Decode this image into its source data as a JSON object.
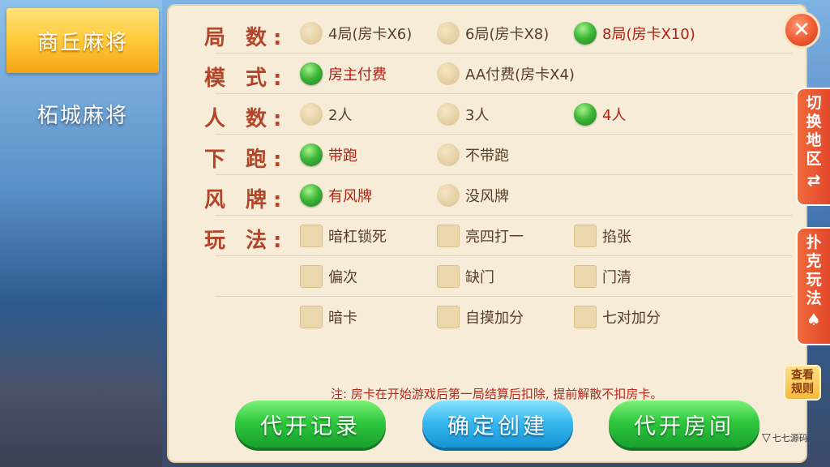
{
  "sidebar": {
    "items": [
      {
        "label": "商丘麻将",
        "active": true
      },
      {
        "label": "柘城麻将",
        "active": false
      }
    ]
  },
  "settings": {
    "rounds": {
      "label": "局 数:",
      "options": [
        "4局(房卡X6)",
        "6局(房卡X8)",
        "8局(房卡X10)"
      ],
      "selected": "8局(房卡X10)"
    },
    "mode": {
      "label": "模 式:",
      "options": [
        "房主付费",
        "AA付费(房卡X4)"
      ],
      "selected": "房主付费"
    },
    "players": {
      "label": "人 数:",
      "options": [
        "2人",
        "3人",
        "4人"
      ],
      "selected": "4人"
    },
    "xiapao": {
      "label": "下 跑:",
      "options": [
        "带跑",
        "不带跑"
      ],
      "selected": "带跑"
    },
    "wind": {
      "label": "风 牌:",
      "options": [
        "有风牌",
        "没风牌"
      ],
      "selected": "有风牌"
    },
    "rules": {
      "label": "玩 法:",
      "options": [
        "暗杠锁死",
        "亮四打一",
        "掐张",
        "偏次",
        "缺门",
        "门清",
        "暗卡",
        "自摸加分",
        "七对加分"
      ]
    }
  },
  "note": "注: 房卡在开始游戏后第一局结算后扣除, 提前解散不扣房卡。",
  "buttons": {
    "record": "代开记录",
    "create": "确定创建",
    "open_room": "代开房间"
  },
  "right_tabs": {
    "switch_region": "切换地区",
    "switch_icon": "⇄",
    "poker": "扑克玩法",
    "poker_icon": "♠"
  },
  "view_rules": "查看规则",
  "close_icon": "close-icon",
  "watermark": "七七源码"
}
